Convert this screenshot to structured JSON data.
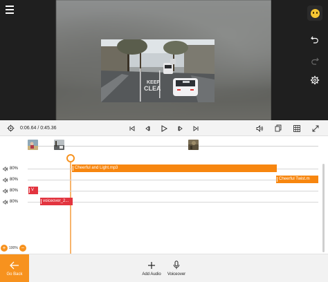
{
  "preview": {
    "menu_icon": "hamburger-icon",
    "side_tools": [
      "emoji-icon",
      "undo-icon",
      "redo-icon",
      "gear-icon"
    ],
    "video_text": "KEEP CLEAR"
  },
  "player": {
    "current_time": "0:06.64",
    "separator": "/",
    "total_time": "0:45.36",
    "controls": [
      "settings-icon",
      "skip-start-icon",
      "frame-back-icon",
      "play-icon",
      "frame-forward-icon",
      "skip-end-icon",
      "volume-icon",
      "copy-icon",
      "grid-icon",
      "fullscreen-icon"
    ]
  },
  "timeline": {
    "tracks": [
      {
        "volume": "80%",
        "clip_label": "Cheerful and Light.mp3",
        "clip_color": "#f7860f"
      },
      {
        "volume": "80%",
        "clip_label": "Cheerful Twist.m",
        "clip_color": "#f7860f"
      },
      {
        "volume": "80%",
        "clip_label": "V",
        "clip_color": "#e2343f"
      },
      {
        "volume": "80%",
        "clip_label": "voiceover_2...",
        "clip_color": "#e2343f"
      }
    ],
    "zoom": "100%",
    "zoom_out_label": "−",
    "zoom_in_label": "+"
  },
  "bottombar": {
    "go_back": "Go Back",
    "add_audio": "Add Audio",
    "voiceover": "Voiceover"
  },
  "colors": {
    "accent": "#f7921e",
    "music_clip": "#f7860f",
    "voice_clip": "#e2343f"
  }
}
